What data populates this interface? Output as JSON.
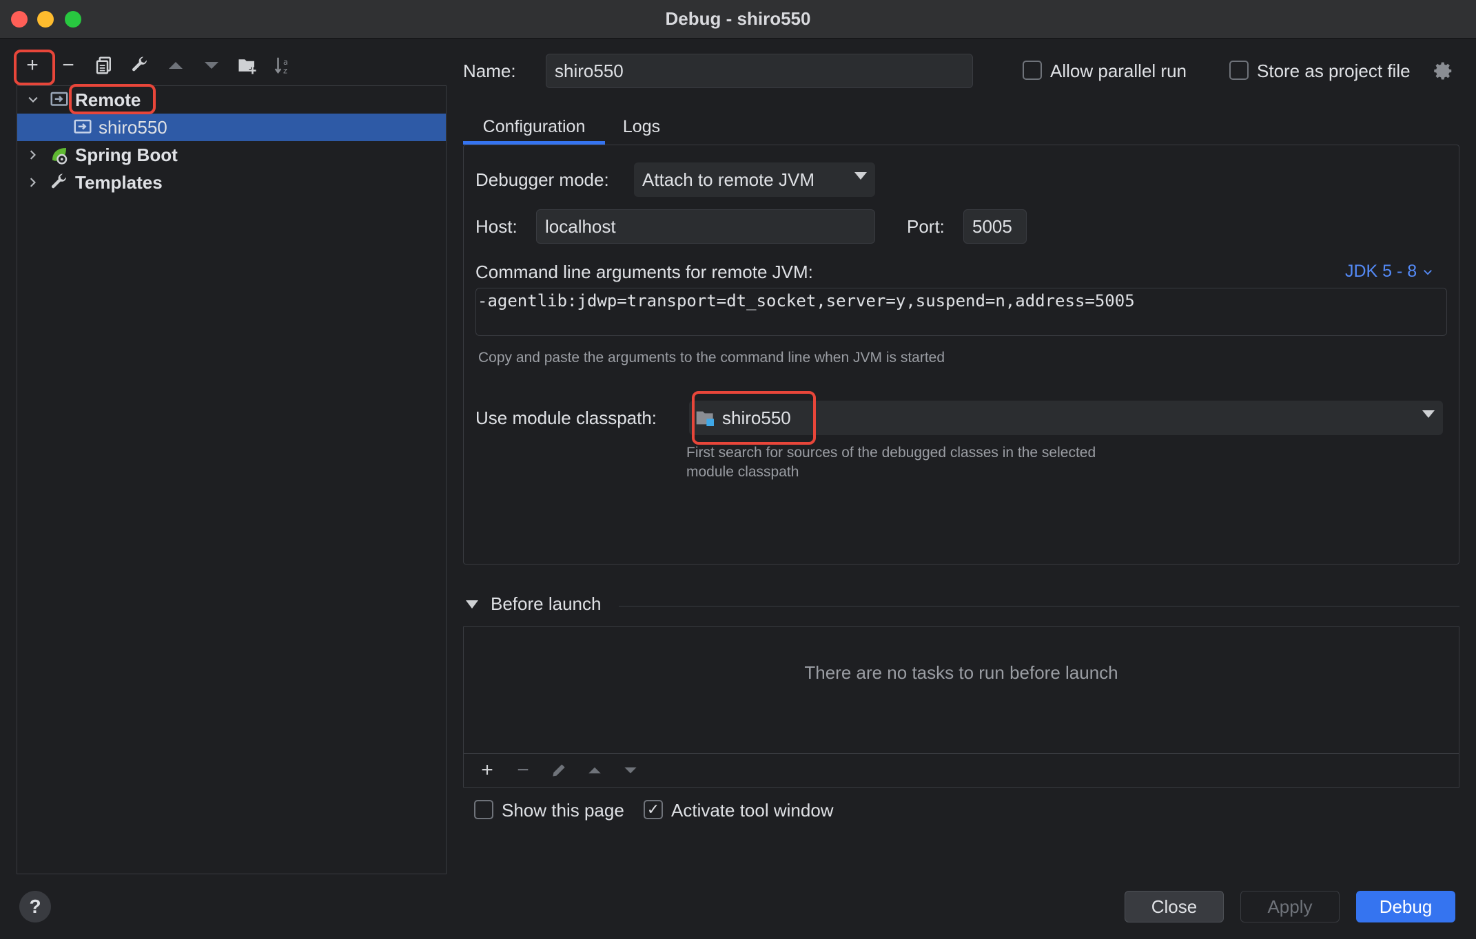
{
  "window": {
    "title": "Debug - shiro550"
  },
  "left_toolbar": {
    "add": "+",
    "remove": "−"
  },
  "tree": {
    "items": [
      {
        "label": "Remote",
        "expanded": true
      },
      {
        "label": "shiro550",
        "selected": true
      },
      {
        "label": "Spring Boot",
        "expanded": false
      },
      {
        "label": "Templates",
        "expanded": false
      }
    ]
  },
  "name_row": {
    "label": "Name:",
    "value": "shiro550",
    "allow_parallel": {
      "label": "Allow parallel run",
      "checked": false
    },
    "store_project": {
      "label": "Store as project file",
      "checked": false
    }
  },
  "tabs": [
    {
      "label": "Configuration",
      "active": true
    },
    {
      "label": "Logs",
      "active": false
    }
  ],
  "config": {
    "debugger_mode_label": "Debugger mode:",
    "debugger_mode_value": "Attach to remote JVM",
    "host_label": "Host:",
    "host_value": "localhost",
    "port_label": "Port:",
    "port_value": "5005",
    "cmd_label": "Command line arguments for remote JVM:",
    "jdk_link": "JDK 5 - 8",
    "cmd_value": "-agentlib:jdwp=transport=dt_socket,server=y,suspend=n,address=5005",
    "cmd_hint": "Copy and paste the arguments to the command line when JVM is started",
    "module_label": "Use module classpath:",
    "module_value": "shiro550",
    "module_hint_1": "First search for sources of the debugged classes in the selected",
    "module_hint_2": "module classpath"
  },
  "before_launch": {
    "header": "Before launch",
    "empty_text": "There are no tasks to run before launch",
    "add": "+",
    "remove": "−"
  },
  "options": {
    "show_page": {
      "label": "Show this page",
      "checked": false
    },
    "activate_tool": {
      "label": "Activate tool window",
      "checked": true,
      "mark": "✓"
    }
  },
  "buttons": {
    "help": "?",
    "close": "Close",
    "apply": "Apply",
    "debug": "Debug"
  },
  "colors": {
    "accent": "#3574f0",
    "highlight_box": "#e8463a",
    "selection": "#2e5aa6"
  }
}
